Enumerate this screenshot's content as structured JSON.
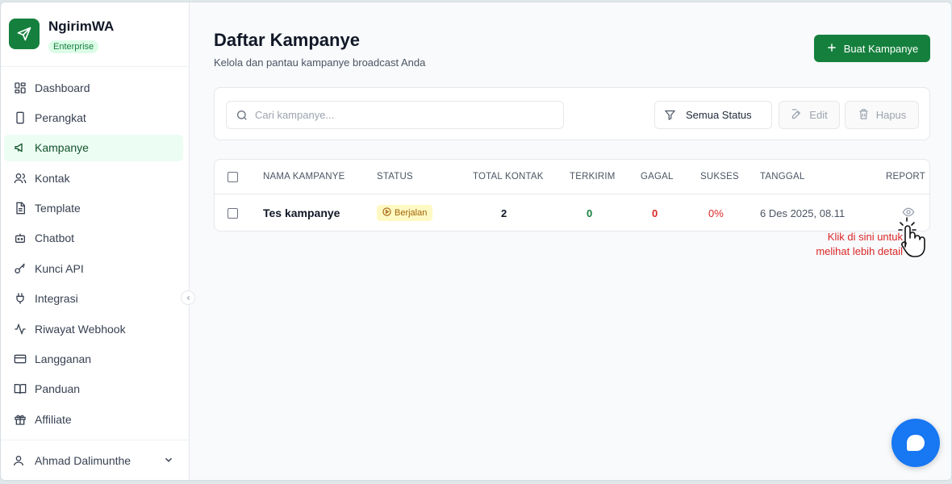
{
  "app": {
    "name": "NgirimWA",
    "plan": "Enterprise",
    "accent": "#15803d"
  },
  "sidebar": {
    "items": [
      {
        "label": "Dashboard",
        "icon": "dashboard-icon"
      },
      {
        "label": "Perangkat",
        "icon": "device-icon"
      },
      {
        "label": "Kampanye",
        "icon": "megaphone-icon",
        "active": true
      },
      {
        "label": "Kontak",
        "icon": "users-icon"
      },
      {
        "label": "Template",
        "icon": "document-icon"
      },
      {
        "label": "Chatbot",
        "icon": "bot-icon"
      },
      {
        "label": "Kunci API",
        "icon": "key-icon"
      },
      {
        "label": "Integrasi",
        "icon": "plug-icon"
      },
      {
        "label": "Riwayat Webhook",
        "icon": "activity-icon"
      },
      {
        "label": "Langganan",
        "icon": "credit-card-icon"
      },
      {
        "label": "Panduan",
        "icon": "book-icon"
      },
      {
        "label": "Affiliate",
        "icon": "gift-icon"
      }
    ],
    "user": "Ahmad Dalimunthe"
  },
  "page": {
    "title": "Daftar Kampanye",
    "subtitle": "Kelola dan pantau kampanye broadcast Anda",
    "create_button": "Buat Kampanye"
  },
  "toolbar": {
    "search_placeholder": "Cari kampanye...",
    "filter_label": "Semua Status",
    "edit_label": "Edit",
    "delete_label": "Hapus"
  },
  "table": {
    "columns": [
      "NAMA KAMPANYE",
      "STATUS",
      "TOTAL KONTAK",
      "TERKIRIM",
      "GAGAL",
      "SUKSES",
      "TANGGAL",
      "REPORT"
    ],
    "rows": [
      {
        "name": "Tes kampanye",
        "status": "Berjalan",
        "total": "2",
        "sent": "0",
        "failed": "0",
        "success": "0%",
        "date": "6 Des 2025, 08.11"
      }
    ]
  },
  "annotation": {
    "line1": "Klik di sini untuk",
    "line2": "melihat lebih detail"
  }
}
